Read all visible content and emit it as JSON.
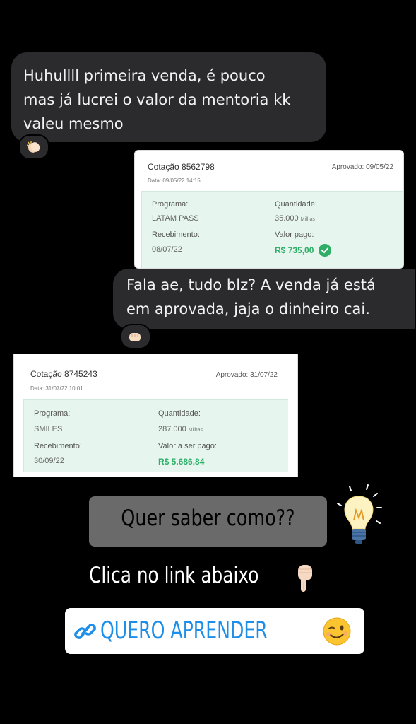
{
  "message1": {
    "lines": [
      "Huhullll primeira venda, é pouco",
      "mas já lucrei o valor da mentoria kk",
      "valeu mesmo"
    ],
    "reaction_icon": "clapping-hands-icon"
  },
  "card1": {
    "quote_id": "Cotação 8562798",
    "approved": "Aprovado: 09/05/22",
    "date": "Data: 09/05/22 14:15",
    "program_label": "Programa:",
    "program_value": "LATAM PASS",
    "quantity_label": "Quantidade:",
    "quantity_value": "35.000",
    "quantity_unit": "Milhas",
    "receipt_label": "Recebimento:",
    "receipt_value": "08/07/22",
    "paid_label": "Valor pago:",
    "paid_value": "R$ 735,00",
    "accent": "#2eae67"
  },
  "message2": {
    "lines": [
      "Fala ae, tudo blz? A venda já está",
      "em aprovada, jaja o dinheiro cai."
    ],
    "reaction_icon": "fist-bump-icon"
  },
  "card2": {
    "quote_id": "Cotação 8745243",
    "approved": "Aprovado: 31/07/22",
    "date": "Data: 31/07/22 10:01",
    "program_label": "Programa:",
    "program_value": "SMILES",
    "quantity_label": "Quantidade:",
    "quantity_value": "287.000",
    "quantity_unit": "Milhas",
    "receipt_label": "Recebimento:",
    "receipt_value": "30/09/22",
    "paid_label": "Valor a ser pago:",
    "paid_value": "R$ 5.686,84"
  },
  "promo": {
    "question": "Quer saber como??",
    "question_icon": "light-bulb-icon",
    "instruction": "Clica no link abaixo",
    "instruction_icon": "pointing-down-hand-icon",
    "cta_label": "QUERO APRENDER",
    "cta_icon": "link-icon",
    "cta_emoji": "winking-face-icon",
    "cta_color": "#1e8fe8"
  }
}
